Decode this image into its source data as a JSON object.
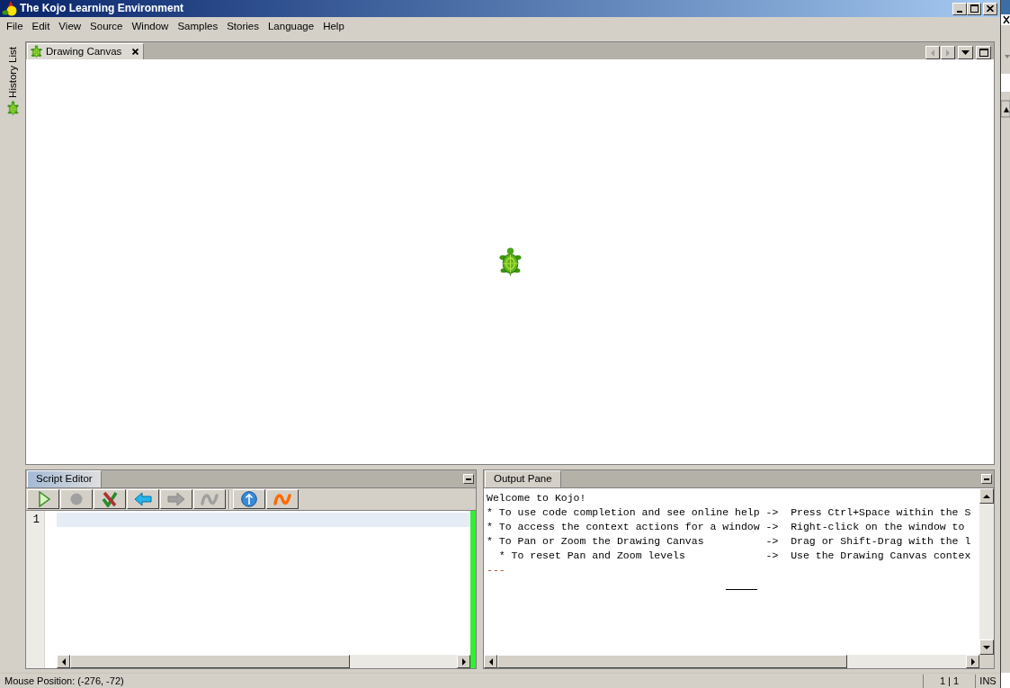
{
  "window": {
    "title": "The Kojo Learning Environment"
  },
  "menu": [
    "File",
    "Edit",
    "View",
    "Source",
    "Window",
    "Samples",
    "Stories",
    "Language",
    "Help"
  ],
  "sidebar": {
    "items": [
      {
        "label": "History List"
      }
    ]
  },
  "canvas": {
    "tab": {
      "label": "Drawing Canvas",
      "focused": false
    },
    "nav_buttons": [
      {
        "kind": "prev",
        "disabled": true
      },
      {
        "kind": "next",
        "disabled": true
      }
    ]
  },
  "script_editor": {
    "tab": {
      "label": "Script Editor",
      "focused": true
    },
    "toolbar": {
      "groups": [
        [
          {
            "kind": "play",
            "disabled": false
          },
          {
            "kind": "stop",
            "disabled": true
          },
          {
            "kind": "check",
            "disabled": false
          },
          {
            "kind": "back",
            "disabled": false
          },
          {
            "kind": "forward",
            "disabled": true
          },
          {
            "kind": "wave",
            "disabled": true
          }
        ],
        [
          {
            "kind": "up",
            "disabled": false
          },
          {
            "kind": "wave",
            "disabled": false
          }
        ]
      ]
    },
    "line_numbers": [
      "1"
    ]
  },
  "output_pane": {
    "tab": {
      "label": "Output Pane",
      "focused": false
    },
    "lines": [
      {
        "kind": "text",
        "text": "Welcome to Kojo!"
      },
      {
        "kind": "text",
        "text": "* To use code completion and see online help ->  Press Ctrl+Space within the S"
      },
      {
        "kind": "text",
        "text": "* To access the context actions for a window ->  Right-click on the window to"
      },
      {
        "kind": "text",
        "text": "* To Pan or Zoom the Drawing Canvas          ->  Drag or Shift-Drag with the l"
      },
      {
        "kind": "text",
        "text": "  * To reset Pan and Zoom levels             ->  Use the Drawing Canvas contex"
      },
      {
        "kind": "separator",
        "text": "---"
      }
    ]
  },
  "status_bar": {
    "fields": [
      "Mouse Position: (-276, -72)",
      "1 | 1",
      "INS"
    ]
  }
}
